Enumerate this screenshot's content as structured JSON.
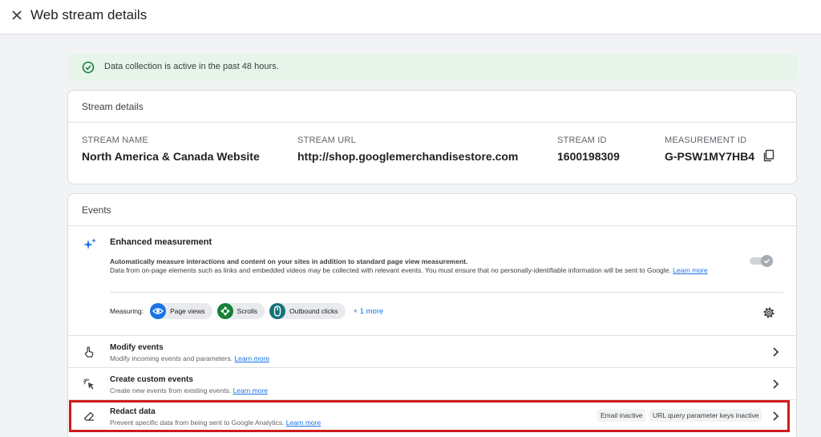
{
  "header": {
    "title": "Web stream details"
  },
  "banner": {
    "text": "Data collection is active in the past 48 hours."
  },
  "stream_details": {
    "title": "Stream details",
    "fields": [
      {
        "label": "STREAM NAME",
        "value": "North America & Canada Website"
      },
      {
        "label": "STREAM URL",
        "value": "http://shop.googlemerchandisestore.com"
      },
      {
        "label": "STREAM ID",
        "value": "1600198309"
      },
      {
        "label": "MEASUREMENT ID",
        "value": "G-PSW1MY7HB4"
      }
    ]
  },
  "events": {
    "title": "Events",
    "enhanced": {
      "title": "Enhanced measurement",
      "desc_line1": "Automatically measure interactions and content on your sites in addition to standard page view measurement.",
      "desc_line2": "Data from on-page elements such as links and embedded videos may be collected with relevant events. You must ensure that no personally-identifiable information will be sent to Google.",
      "learn_more": "Learn more",
      "toggle_on": true,
      "measuring_label": "Measuring:",
      "chips": [
        "Page views",
        "Scrolls",
        "Outbound clicks"
      ],
      "more": "+ 1 more"
    },
    "rows": [
      {
        "title": "Modify events",
        "subtitle": "Modify incoming events and parameters.",
        "link": "Learn more"
      },
      {
        "title": "Create custom events",
        "subtitle": "Create new events from existing events.",
        "link": "Learn more"
      },
      {
        "title": "Redact data",
        "subtitle": "Prevent specific data from being sent to Google Analytics.",
        "link": "Learn more",
        "badges": [
          "Email inactive",
          "URL query parameter keys inactive"
        ]
      }
    ]
  },
  "colors": {
    "accent": "#1a73e8",
    "success_bg": "#e6f4ea",
    "success_icon": "#188038",
    "highlight": "#d01b1b"
  }
}
